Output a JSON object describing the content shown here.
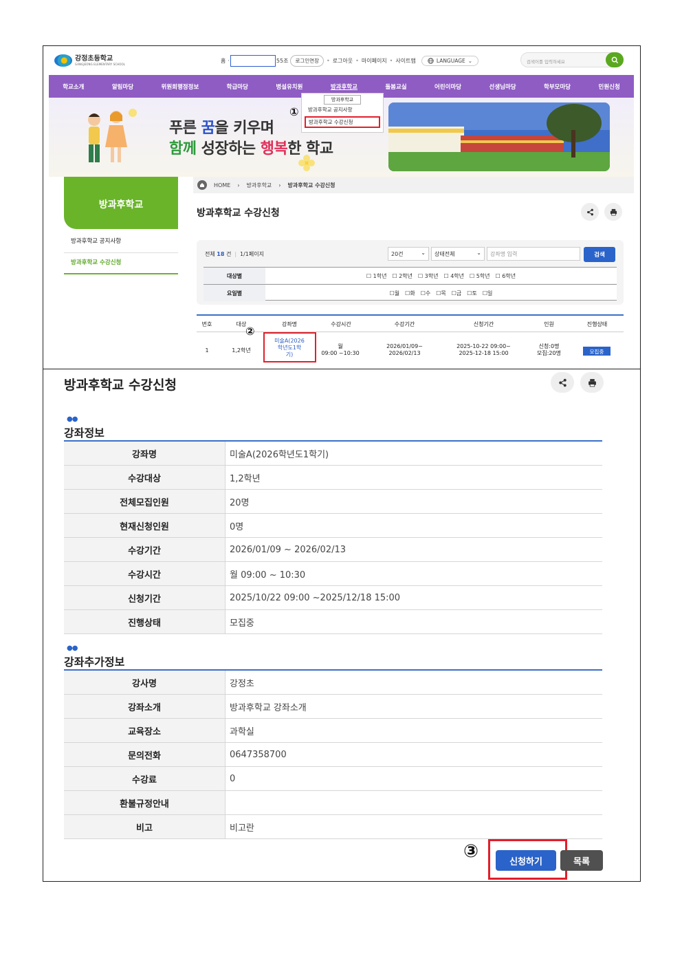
{
  "top": {
    "logo_name": "강정초등학교",
    "logo_sub": "GANGJEONG ELEMENTARY SCHOOL",
    "util_home": "홈",
    "util_fragment": "55조",
    "util_links": [
      "로그인연장",
      "로그아웃",
      "마이페이지",
      "사이트맵"
    ],
    "language": "LANGUAGE",
    "search_placeholder": "검색어를 입력하세요"
  },
  "gnb": [
    "학교소개",
    "알림마당",
    "위원회행정정보",
    "학급마당",
    "병설유치원",
    "방과후학교",
    "돌봄교실",
    "어린이마당",
    "선생님마당",
    "학부모마당",
    "민원신청"
  ],
  "dropdown": {
    "title": "방과후학교",
    "items": [
      "방과후학교 공지사항",
      "방과후학교 수강신청"
    ]
  },
  "markers": [
    "①",
    "②",
    "③"
  ],
  "banner": {
    "line1_a": "푸른 ",
    "line1_b": "꿈",
    "line1_c": "을 키우며",
    "line2_a": "함께",
    "line2_b": " 성장하는 ",
    "line2_c": "행복",
    "line2_d": "한 학교"
  },
  "sidebar": {
    "title": "방과후학교",
    "items": [
      "방과후학교 공지사항",
      "방과후학교 수강신청"
    ]
  },
  "breadcrumb": [
    "HOME",
    "방과후학교",
    "방과후학교 수강신청"
  ],
  "page_title": "방과후학교 수강신청",
  "filter": {
    "count_prefix": "전체 ",
    "count_value": "18",
    "count_suffix": " 건",
    "pages": "1/1페이지",
    "per_page": "20건",
    "status": "상태전체",
    "lecture_placeholder": "강좌명 입력",
    "search_button": "검색",
    "grade_label": "대상별",
    "grade_options": "☐ 1학년　☐ 2학년　☐ 3학년　☐ 4학년　☐ 5학년　☐ 6학년",
    "day_label": "요일별",
    "day_options": "☐월　☐화　☐수　☐목　☐금　☐토　☐일"
  },
  "table": {
    "headers": [
      "번호",
      "대상",
      "강좌명",
      "수강시간",
      "수강기간",
      "신청기간",
      "인원",
      "진행상태"
    ],
    "row": {
      "no": "1",
      "target": "1,2학년",
      "lecture": [
        "미술A(2026",
        "학년도1학",
        "기)"
      ],
      "time": [
        "월",
        "09:00 ~10:30"
      ],
      "period": [
        "2026/01/09~",
        "2026/02/13"
      ],
      "apply": [
        "2025-10-22 09:00~",
        "2025-12-18 15:00"
      ],
      "people": [
        "신청:0명",
        "모집:20명"
      ],
      "status": "모집중"
    }
  },
  "detail": {
    "title": "방과후학교 수강신청",
    "section1": "강좌정보",
    "rows1": [
      {
        "label": "강좌명",
        "value": "미술A(2026학년도1학기)"
      },
      {
        "label": "수강대상",
        "value": "1,2학년"
      },
      {
        "label": "전체모집인원",
        "value": "20명"
      },
      {
        "label": "현재신청인원",
        "value": "0명"
      },
      {
        "label": "수강기간",
        "value": "2026/01/09 ~ 2026/02/13"
      },
      {
        "label": "수강시간",
        "value": "월 09:00 ~ 10:30"
      },
      {
        "label": "신청기간",
        "value": "2025/10/22 09:00 ~2025/12/18 15:00"
      },
      {
        "label": "진행상태",
        "value": "모집중"
      }
    ],
    "section2": "강좌추가정보",
    "rows2": [
      {
        "label": "강사명",
        "value": "강정초"
      },
      {
        "label": "강좌소개",
        "value": "방과후학교 강좌소개"
      },
      {
        "label": "교육장소",
        "value": "과학실"
      },
      {
        "label": "문의전화",
        "value": "0647358700"
      },
      {
        "label": "수강료",
        "value": "0"
      },
      {
        "label": "환불규정안내",
        "value": ""
      },
      {
        "label": "비고",
        "value": "비고란"
      }
    ],
    "apply_button": "신청하기",
    "list_button": "목록"
  },
  "colors": {
    "purple": "#8f5cc4",
    "green": "#6ab42a",
    "blue": "#2a63c9",
    "red": "#e21e2a"
  }
}
